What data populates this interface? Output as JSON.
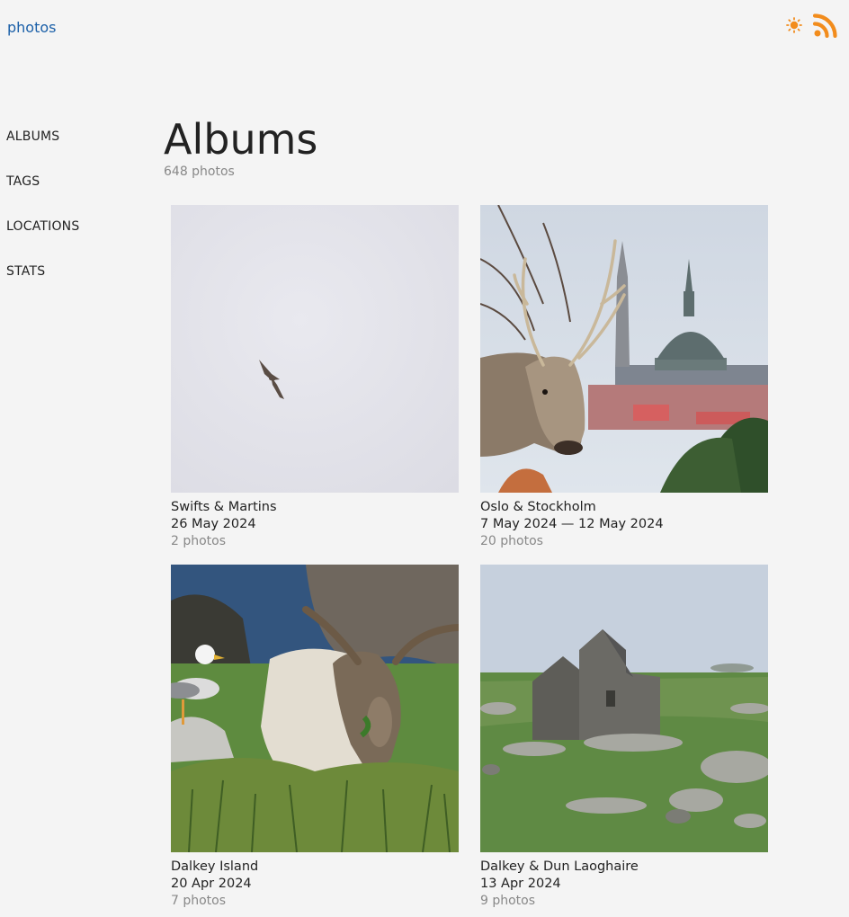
{
  "header": {
    "site_title": "photos",
    "theme_icon": "sun-icon",
    "feed_icon": "rss-icon",
    "accent_color": "#1a5fa8",
    "icon_color": "#f28c1c"
  },
  "sidebar": {
    "items": [
      {
        "label": "ALBUMS"
      },
      {
        "label": "TAGS"
      },
      {
        "label": "LOCATIONS"
      },
      {
        "label": "STATS"
      }
    ]
  },
  "main": {
    "title": "Albums",
    "count": "648 photos",
    "albums": [
      {
        "title": "Swifts & Martins",
        "date": "26 May 2024",
        "count": "2 photos"
      },
      {
        "title": "Oslo & Stockholm",
        "date": "7 May 2024 — 12 May 2024",
        "count": "20 photos"
      },
      {
        "title": "Dalkey Island",
        "date": "20 Apr 2024",
        "count": "7 photos"
      },
      {
        "title": "Dalkey & Dun Laoghaire",
        "date": "13 Apr 2024",
        "count": "9 photos"
      }
    ]
  }
}
